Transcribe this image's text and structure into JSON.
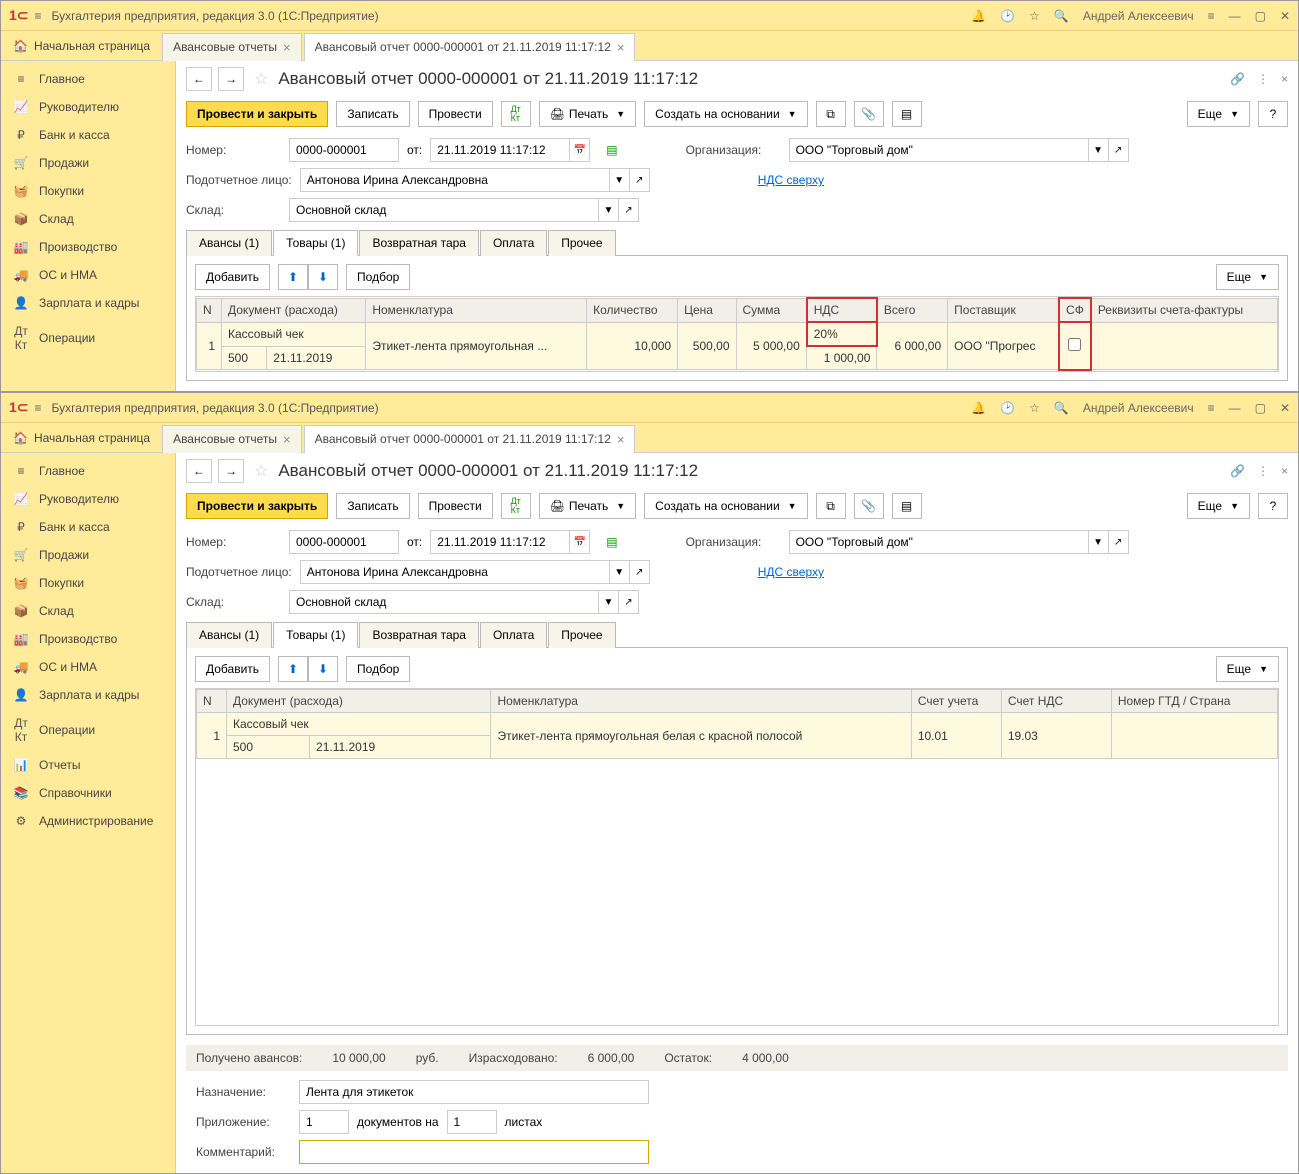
{
  "app": {
    "title": "Бухгалтерия предприятия, редакция 3.0  (1С:Предприятие)",
    "user": "Андрей Алексеевич"
  },
  "win_tabs": {
    "home": "Начальная страница",
    "t1": "Авансовые отчеты",
    "t2": "Авансовый отчет 0000-000001 от 21.11.2019 11:17:12"
  },
  "sidebar": {
    "items": [
      "Главное",
      "Руководителю",
      "Банк и касса",
      "Продажи",
      "Покупки",
      "Склад",
      "Производство",
      "ОС и НМА",
      "Зарплата и кадры",
      "Операции",
      "Отчеты",
      "Справочники",
      "Администрирование"
    ]
  },
  "doc": {
    "title": "Авансовый отчет 0000-000001 от 21.11.2019 11:17:12",
    "post_close": "Провести и закрыть",
    "save": "Записать",
    "post": "Провести",
    "print": "Печать",
    "create_based": "Создать на основании",
    "more": "Еще",
    "number_label": "Номер:",
    "number": "0000-000001",
    "from": "от:",
    "date": "21.11.2019 11:17:12",
    "org_label": "Организация:",
    "org": "ООО \"Торговый дом\"",
    "person_label": "Подотчетное лицо:",
    "person": "Антонова Ирина Александровна",
    "vat_link": "НДС сверху",
    "stock_label": "Склад:",
    "stock": "Основной склад",
    "tabs": {
      "advances": "Авансы (1)",
      "goods": "Товары (1)",
      "returnable": "Возвратная тара",
      "payment": "Оплата",
      "other": "Прочее"
    },
    "add": "Добавить",
    "pick": "Подбор"
  },
  "grid1": {
    "cols": {
      "n": "N",
      "doc": "Документ (расхода)",
      "nom": "Номенклатура",
      "qty": "Количество",
      "price": "Цена",
      "sum": "Сумма",
      "vat": "НДС",
      "total": "Всего",
      "supplier": "Поставщик",
      "sf": "СФ",
      "req": "Реквизиты счета-фактуры"
    },
    "row": {
      "n": "1",
      "doc1": "Кассовый чек",
      "doc2": "500",
      "doc3": "21.11.2019",
      "nom": "Этикет-лента прямоугольная ...",
      "qty": "10,000",
      "price": "500,00",
      "sum": "5 000,00",
      "vat": "20%",
      "vat_sum": "1 000,00",
      "total": "6 000,00",
      "supplier": "ООО \"Прогрес"
    }
  },
  "grid2": {
    "cols": {
      "n": "N",
      "doc": "Документ (расхода)",
      "nom": "Номенклатура",
      "acc": "Счет учета",
      "vat_acc": "Счет НДС",
      "gtd": "Номер ГТД / Страна"
    },
    "row": {
      "n": "1",
      "doc1": "Кассовый чек",
      "doc2": "500",
      "doc3": "21.11.2019",
      "nom": "Этикет-лента прямоугольная белая с красной полосой",
      "acc": "10.01",
      "vat_acc": "19.03"
    }
  },
  "footer": {
    "received": "Получено авансов:",
    "received_v": "10 000,00",
    "rub": "руб.",
    "spent": "Израсходовано:",
    "spent_v": "6 000,00",
    "rest": "Остаток:",
    "rest_v": "4 000,00"
  },
  "bottom": {
    "purpose_label": "Назначение:",
    "purpose": "Лента для этикеток",
    "attach_label": "Приложение:",
    "docs": "1",
    "docs_on": "документов на",
    "sheets": "1",
    "sheets_l": "листах",
    "comment_label": "Комментарий:"
  }
}
